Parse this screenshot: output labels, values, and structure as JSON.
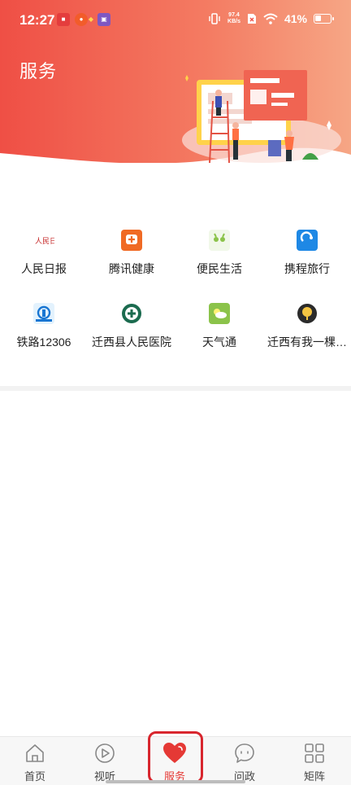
{
  "status_bar": {
    "time": "12:27",
    "net_speed_value": "97.4",
    "net_speed_unit": "KB/s",
    "battery": "41%",
    "battery_level": 0.41
  },
  "page": {
    "title": "服务"
  },
  "services": [
    {
      "label": "人民日报",
      "icon": "people-daily-icon",
      "color": "#c62828"
    },
    {
      "label": "腾讯健康",
      "icon": "tencent-health-icon",
      "color": "#f06a24"
    },
    {
      "label": "便民生活",
      "icon": "convenience-life-icon",
      "color": "#8bc34a"
    },
    {
      "label": "携程旅行",
      "icon": "ctrip-icon",
      "color": "#1e88e5"
    },
    {
      "label": "铁路12306",
      "icon": "railway-12306-icon",
      "color": "#1976d2"
    },
    {
      "label": "迁西县人民医院",
      "icon": "hospital-icon",
      "color": "#1b6b4f"
    },
    {
      "label": "天气通",
      "icon": "weather-icon",
      "color": "#8bc34a"
    },
    {
      "label": "迁西有我一棵…",
      "icon": "qianxi-tree-icon",
      "color": "#2b2b2b"
    }
  ],
  "tabs": [
    {
      "label": "首页",
      "icon": "home-icon"
    },
    {
      "label": "视听",
      "icon": "play-icon"
    },
    {
      "label": "服务",
      "icon": "heart-icon",
      "active": true
    },
    {
      "label": "问政",
      "icon": "chat-icon"
    },
    {
      "label": "矩阵",
      "icon": "grid-icon"
    }
  ],
  "colors": {
    "accent": "#ef4f45",
    "active_tab": "#e53935"
  }
}
